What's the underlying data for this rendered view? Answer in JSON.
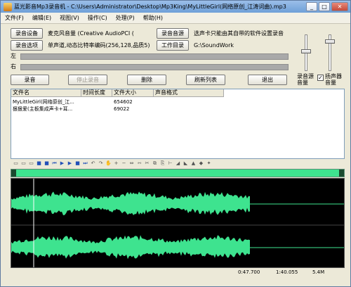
{
  "window": {
    "title": "蓝光影音Mp3录音机 - C:\\Users\\Administrator\\Desktop\\Mp3King\\MyLittleGirl(网络原创_江涛词曲).mp3",
    "minimize": "_",
    "maximize": "□",
    "close": "✕"
  },
  "menu": [
    "文件(F)",
    "编辑(E)",
    "视图(V)",
    "操作(C)",
    "处理(P)",
    "帮助(H)"
  ],
  "controls": {
    "record_device_button": "录音设备",
    "record_device_value": "麦克风音量 (Creative AudioPCI (",
    "record_source_button": "录音音源",
    "record_source_hint": "选声卡只能由其自带的软件设置录音",
    "record_options_button": "录音选项",
    "record_options_value": "单声道,动态比特率编码(256,128,品质5)",
    "work_dir_button": "工作目录",
    "work_dir_value": "G:\\SoundWork",
    "left_channel": "左",
    "right_channel": "右"
  },
  "actions": {
    "record": "录音",
    "stop": "停止录音",
    "delete": "删除",
    "refresh": "刷新列表",
    "exit": "退出"
  },
  "volume": {
    "source_label_1": "录音源",
    "source_label_2": "音量",
    "speaker_label_1": "扬声器",
    "speaker_label_2": "音量",
    "speaker_checked": true,
    "source_level": 0.55,
    "speaker_level": 0.85
  },
  "filelist": {
    "columns": [
      "文件名",
      "时间长度",
      "文件大小",
      "声音格式"
    ],
    "rows": [
      {
        "name": "MyLittleGirl(网络原创_江...",
        "length": "",
        "size": "654602",
        "format": ""
      },
      {
        "name": "狠狠爱(主板集成声卡+耳...",
        "length": "",
        "size": "69022",
        "format": ""
      }
    ]
  },
  "status": {
    "time": "0:47.700",
    "total": "1:40.055",
    "size": "5.4M"
  },
  "colors": {
    "waveform": "#3ee38f",
    "wave_bg": "#000000",
    "overview": "#3ee38f"
  }
}
